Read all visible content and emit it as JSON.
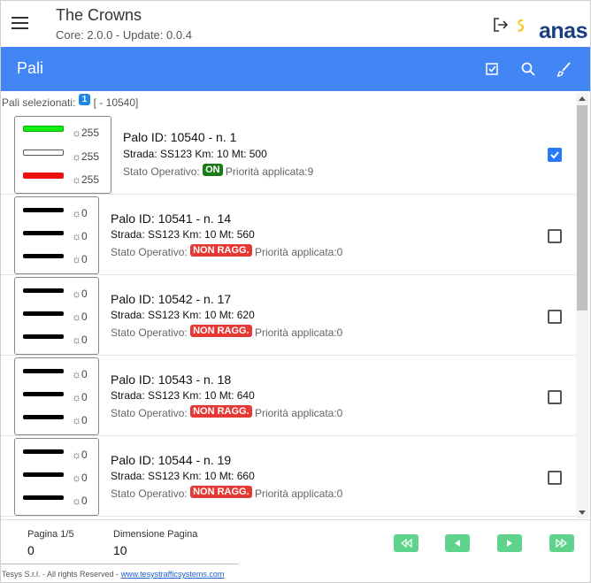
{
  "header": {
    "title": "The Crowns",
    "version": "Core: 2.0.0 - Update: 0.0.4",
    "logo_text": "anas"
  },
  "toolbar": {
    "title": "Pali",
    "icons": [
      "select-all-icon",
      "search-icon",
      "brush-icon"
    ]
  },
  "selection": {
    "label": "Pali selezionati:",
    "count": "1",
    "ids": "[ - 10540]"
  },
  "rows": [
    {
      "title": "Palo ID: 10540 - n. 1",
      "strada": "Strada: SS123 Km: 10 Mt: 500",
      "stato_label": "Stato Operativo:",
      "stato": "ON",
      "priorita": "Priorità applicata:9",
      "lamps": [
        {
          "color": "green",
          "value": "255"
        },
        {
          "color": "white",
          "value": "255"
        },
        {
          "color": "red",
          "value": "255"
        }
      ],
      "checked": true
    },
    {
      "title": "Palo ID: 10541 - n. 14",
      "strada": "Strada: SS123 Km: 10 Mt: 560",
      "stato_label": "Stato Operativo:",
      "stato": "NON RAGG.",
      "priorita": "Priorità applicata:0",
      "lamps": [
        {
          "color": "black",
          "value": "0"
        },
        {
          "color": "black",
          "value": "0"
        },
        {
          "color": "black",
          "value": "0"
        }
      ],
      "checked": false
    },
    {
      "title": "Palo ID: 10542 - n. 17",
      "strada": "Strada: SS123 Km: 10 Mt: 620",
      "stato_label": "Stato Operativo:",
      "stato": "NON RAGG.",
      "priorita": "Priorità applicata:0",
      "lamps": [
        {
          "color": "black",
          "value": "0"
        },
        {
          "color": "black",
          "value": "0"
        },
        {
          "color": "black",
          "value": "0"
        }
      ],
      "checked": false
    },
    {
      "title": "Palo ID: 10543 - n. 18",
      "strada": "Strada: SS123 Km: 10 Mt: 640",
      "stato_label": "Stato Operativo:",
      "stato": "NON RAGG.",
      "priorita": "Priorità applicata:0",
      "lamps": [
        {
          "color": "black",
          "value": "0"
        },
        {
          "color": "black",
          "value": "0"
        },
        {
          "color": "black",
          "value": "0"
        }
      ],
      "checked": false
    },
    {
      "title": "Palo ID: 10544 - n. 19",
      "strada": "Strada: SS123 Km: 10 Mt: 660",
      "stato_label": "Stato Operativo:",
      "stato": "NON RAGG.",
      "priorita": "Priorità applicata:0",
      "lamps": [
        {
          "color": "black",
          "value": "0"
        },
        {
          "color": "black",
          "value": "0"
        },
        {
          "color": "black",
          "value": "0"
        }
      ],
      "checked": false
    }
  ],
  "pager": {
    "page_label": "Pagina 1/5",
    "page_value": "0",
    "size_label": "Dimensione Pagina",
    "size_value": "10"
  },
  "footer": {
    "copyright": "Tesys S.r.l. - All rights Reserved -",
    "link": "www.tesystrafficsystems.com"
  },
  "colors": {
    "primary": "#4285f4",
    "on": "#1a7a1a",
    "off": "#e53935",
    "pager_button": "#5ed38b",
    "checkbox": "#2979ff"
  }
}
